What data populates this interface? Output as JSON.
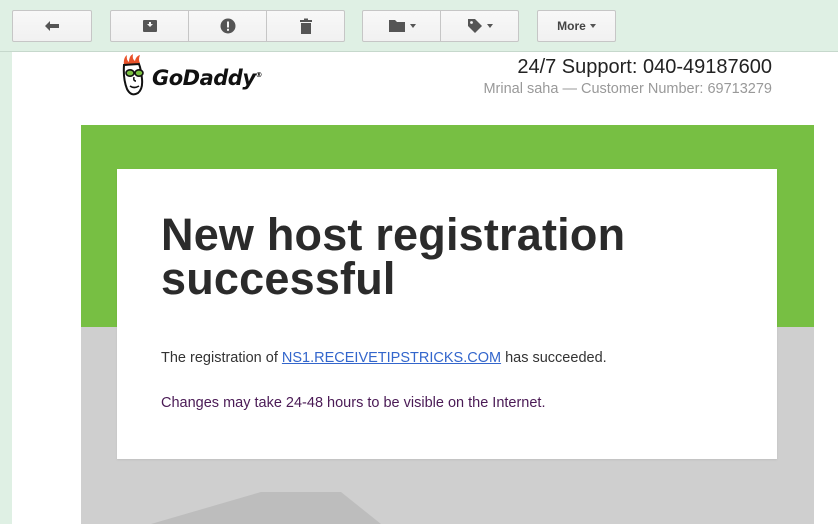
{
  "toolbar": {
    "buttons": [
      {
        "name": "reply",
        "icon": "reply-arrow-icon"
      },
      {
        "name": "archive",
        "icon": "archive-icon"
      },
      {
        "name": "spam",
        "icon": "report-spam-icon"
      },
      {
        "name": "delete",
        "icon": "trash-icon"
      },
      {
        "name": "move",
        "icon": "folder-icon",
        "dropdown": true
      },
      {
        "name": "labels",
        "icon": "tag-icon",
        "dropdown": true
      }
    ],
    "more_label": "More"
  },
  "email": {
    "logo_text": "GoDaddy",
    "logo_reg": "®",
    "support_line": "24/7 Support: 040-49187600",
    "customer_line": "Mrinal saha — Customer Number: 69713279",
    "headline": "New host registration successful",
    "msg1_prefix": "The registration of ",
    "msg1_link": "NS1.RECEIVETIPSTRICKS.COM",
    "msg1_suffix": " has succeeded.",
    "msg2": "Changes may take 24-48 hours to be visible on the Internet."
  },
  "colors": {
    "toolbar_bg": "#dff0e4",
    "brand_green": "#77bf43",
    "gray_band": "#cfcfcf",
    "link": "#3366cc"
  }
}
